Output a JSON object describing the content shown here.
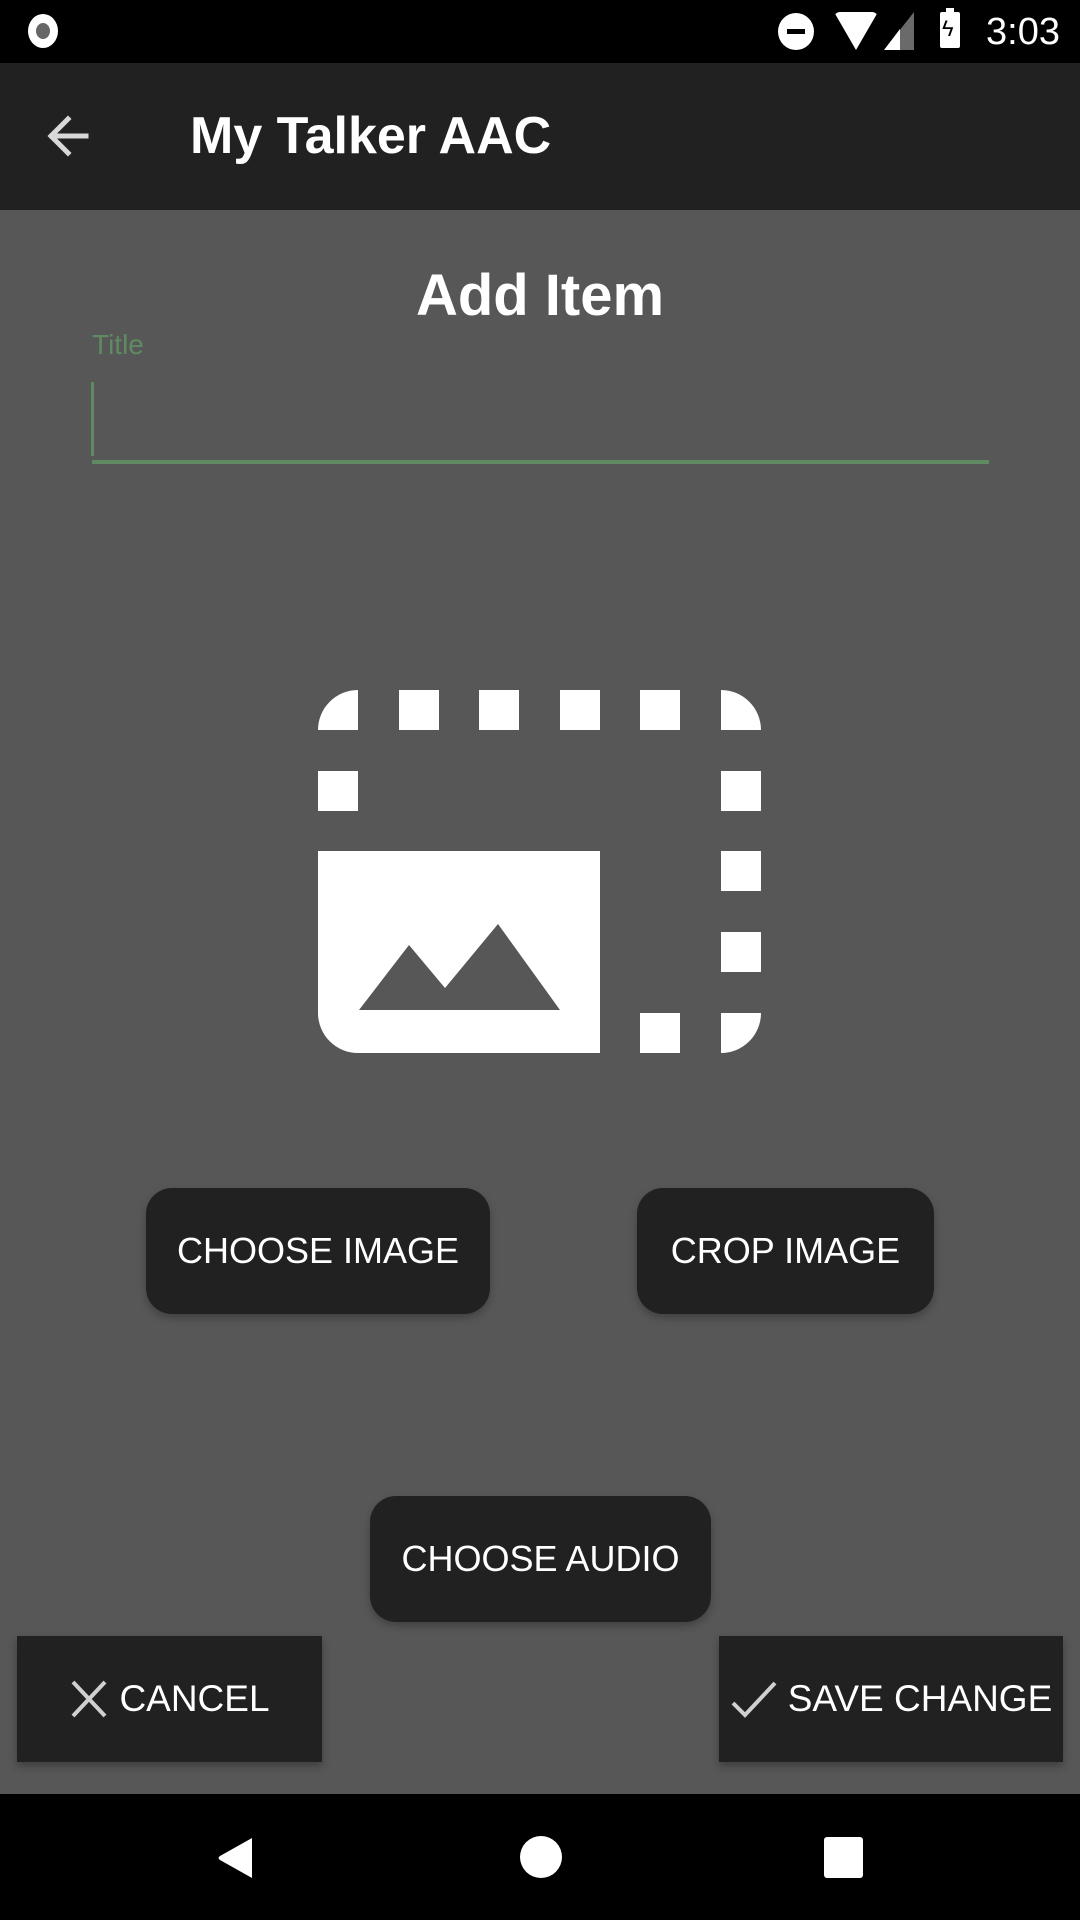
{
  "status_bar": {
    "time": "3:03",
    "icons": [
      "record-icon",
      "do-not-disturb-icon",
      "wifi-icon",
      "signal-icon",
      "battery-charging-icon"
    ]
  },
  "app_bar": {
    "title": "My Talker AAC",
    "back_icon": "arrow-back-icon"
  },
  "form": {
    "heading": "Add Item",
    "title_field": {
      "label": "Title",
      "value": "",
      "placeholder": ""
    },
    "image_placeholder_icon": "photo-size-select-icon"
  },
  "buttons": {
    "choose_image": "CHOOSE IMAGE",
    "crop_image": "CROP IMAGE",
    "choose_audio": "CHOOSE AUDIO",
    "cancel": "CANCEL",
    "save_change": "SAVE CHANGE"
  },
  "colors": {
    "accent": "#5f8a62",
    "app_bar": "#212121",
    "background": "#575757",
    "button": "#212121"
  },
  "nav_bar": {
    "icons": [
      "nav-back-icon",
      "nav-home-icon",
      "nav-recents-icon"
    ]
  }
}
